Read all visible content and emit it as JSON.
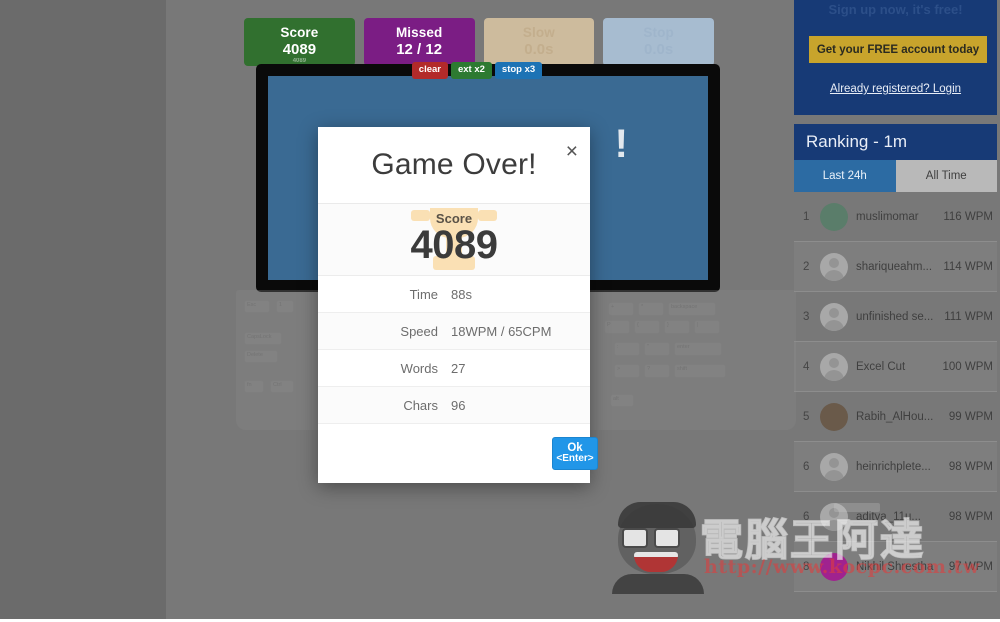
{
  "game": {
    "stats": [
      {
        "name": "score",
        "label": "Score",
        "value": "4089",
        "sub": "4089"
      },
      {
        "name": "missed",
        "label": "Missed",
        "value": "12 / 12",
        "sub": ""
      },
      {
        "name": "slow",
        "label": "Slow",
        "value": "0.0s",
        "sub": ""
      },
      {
        "name": "stop",
        "label": "Stop",
        "value": "0.0s",
        "sub": ""
      }
    ],
    "pills": [
      {
        "name": "clear",
        "label": "clear"
      },
      {
        "name": "ext",
        "label": "ext x2"
      },
      {
        "name": "stop",
        "label": "stop x3"
      }
    ],
    "screen_text": "!"
  },
  "modal": {
    "title": "Game Over!",
    "close_icon": "close-icon",
    "score_label": "Score",
    "score_value": "4089",
    "rows": [
      {
        "key": "Time",
        "value": "88s"
      },
      {
        "key": "Speed",
        "value": "18WPM / 65CPM"
      },
      {
        "key": "Words",
        "value": "27"
      },
      {
        "key": "Chars",
        "value": "96"
      }
    ],
    "ok_label": "Ok",
    "ok_hint": "<Enter>"
  },
  "sidebar": {
    "promo": {
      "heading": "Sign up now, it's free!",
      "button_label": "Get your FREE account today",
      "login_label": "Already registered? Login"
    },
    "ranking": {
      "title": "Ranking - 1m",
      "tabs": [
        {
          "name": "last-24h",
          "label": "Last 24h",
          "active": true
        },
        {
          "name": "all-time",
          "label": "All Time",
          "active": false
        }
      ],
      "rows": [
        {
          "pos": "1",
          "name": "muslimomar",
          "wpm": "116 WPM",
          "avatar": "photo",
          "color": "#5a7d6a"
        },
        {
          "pos": "2",
          "name": "shariqueahm...",
          "wpm": "114 WPM",
          "avatar": "generic",
          "color": "#a8a8a8"
        },
        {
          "pos": "3",
          "name": "unfinished se...",
          "wpm": "111 WPM",
          "avatar": "generic",
          "color": "#a8a8a8"
        },
        {
          "pos": "4",
          "name": "Excel Cut",
          "wpm": "100 WPM",
          "avatar": "generic",
          "color": "#a8a8a8"
        },
        {
          "pos": "5",
          "name": "Rabih_AlHou...",
          "wpm": "99 WPM",
          "avatar": "photo",
          "color": "#6a5a4a"
        },
        {
          "pos": "6",
          "name": "heinrichplete...",
          "wpm": "98 WPM",
          "avatar": "generic",
          "color": "#a8a8a8"
        },
        {
          "pos": "6",
          "name": "aditya_11u...",
          "wpm": "98 WPM",
          "avatar": "generic",
          "color": "#a8a8a8"
        },
        {
          "pos": "8",
          "name": "Nikhil Shrestha",
          "wpm": "97 WPM",
          "avatar": "photo",
          "color": "#a0228f"
        }
      ]
    }
  },
  "watermark": {
    "text_cn": "電腦王阿達",
    "url": "http://www.kocpc.com.tw"
  },
  "keyboard": {
    "keys_left": [
      "Esc",
      "1",
      "CapsLock",
      "Delete",
      "fn",
      "Ctrl"
    ],
    "keys_right": [
      "+",
      "*",
      "backspace",
      "P",
      "{",
      "}",
      "|",
      ":",
      "\"",
      "enter",
      ">",
      "?",
      "shift",
      "alt"
    ]
  },
  "colors": {
    "score_green": "#31702f",
    "missed_purple": "#7b1d84",
    "slow_tan": "#cdbb9d",
    "stop_blue": "#a7bcd0",
    "promo_navy": "#173a76",
    "promo_gold": "#c8a42c",
    "tab_active": "#2c6ba3",
    "ok_blue": "#2196e8",
    "screen_blue": "#3a6a93"
  }
}
